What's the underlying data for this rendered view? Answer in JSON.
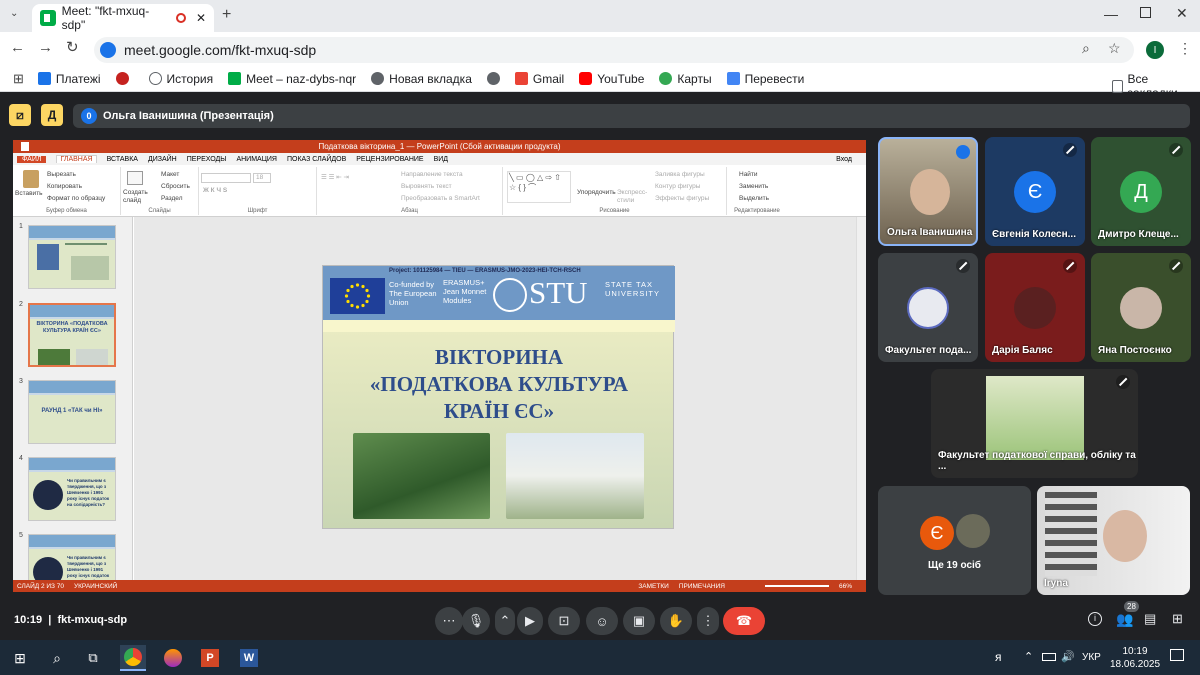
{
  "browser": {
    "tab_title": "Meet: \"fkt-mxuq-sdp\"",
    "url": "meet.google.com/fkt-mxuq-sdp",
    "profile_initial": "I",
    "bookmarks": [
      {
        "label": "Платежі",
        "color": "#1a73e8"
      },
      {
        "label": "",
        "color": "#c5221f"
      },
      {
        "label": "История",
        "color": "#5f6368"
      },
      {
        "label": "Meet – naz-dybs-nqr",
        "color": "#00ac47"
      },
      {
        "label": "Новая вкладка",
        "color": "#5f6368"
      },
      {
        "label": "Gmail",
        "color": "#ea4335"
      },
      {
        "label": "YouTube",
        "color": "#ff0000"
      },
      {
        "label": "Карты",
        "color": "#34a853"
      },
      {
        "label": "Перевести",
        "color": "#4285f4"
      }
    ],
    "all_bookmarks": "Все закладки"
  },
  "meet": {
    "presenter_count": "0",
    "presenter_label": "Ольга Іванишина (Презентація)",
    "badge_a": "Д",
    "participants": [
      {
        "name": "Ольга Іванишина",
        "initial": "",
        "color": "#8a7a60"
      },
      {
        "name": "Євгенія Колесн...",
        "initial": "Є",
        "color": "#1a73e8"
      },
      {
        "name": "Дмитро Клеще...",
        "initial": "Д",
        "color": "#34a853"
      },
      {
        "name": "Факультет пода...",
        "initial": "",
        "color": "#5c6bc0"
      },
      {
        "name": "Дарія Баляс",
        "initial": "",
        "color": "#8b1c1c"
      },
      {
        "name": "Яна Постоєнко",
        "initial": "",
        "color": "#33691e"
      }
    ],
    "shared_tile_name": "Факультет податкової справи, обліку та ...",
    "others_label": "Ще 19 осіб",
    "others_initial": "Є",
    "iryna_name": "Iryna",
    "time": "10:19",
    "meeting_code": "fkt-mxuq-sdp",
    "participants_count": "28"
  },
  "ppt": {
    "title": "Податкова вікторина_1 — PowerPoint (Сбой активации продукта)",
    "login": "Вход",
    "tabs": [
      "ФАЙЛ",
      "ГЛАВНАЯ",
      "ВСТАВКА",
      "ДИЗАЙН",
      "ПЕРЕХОДЫ",
      "АНИМАЦИЯ",
      "ПОКАЗ СЛАЙДОВ",
      "РЕЦЕНЗИРОВАНИЕ",
      "ВИД"
    ],
    "ribbon": {
      "paste": "Вставить",
      "cut": "Вырезать",
      "copy": "Копировать",
      "format_painter": "Формат по образцу",
      "clipboard_group": "Буфер обмена",
      "new_slide": "Создать слайд",
      "layout": "Макет",
      "reset": "Сбросить",
      "section": "Раздел",
      "slides_group": "Слайды",
      "font_size": "18",
      "font_group": "Шрифт",
      "text_direction": "Направление текста",
      "align_text": "Выровнять текст",
      "smartart": "Преобразовать в SmartArt",
      "paragraph_group": "Абзац",
      "arrange": "Упорядочить",
      "quick_styles": "Экспресс-стили",
      "shape_fill": "Заливка фигуры",
      "shape_outline": "Контур фигуры",
      "shape_effects": "Эффекты фигуры",
      "drawing_group": "Рисование",
      "find": "Найти",
      "replace": "Заменить",
      "select": "Выделить",
      "editing_group": "Редактирование"
    },
    "thumbs": [
      {
        "num": "1",
        "text": ""
      },
      {
        "num": "2",
        "text": "ВІКТОРИНА «ПОДАТКОВА КУЛЬТУРА КРАЇН ЄС»"
      },
      {
        "num": "3",
        "text": "РАУНД 1 «ТАК чи НІ»"
      },
      {
        "num": "4",
        "text": "Чи правильним є твердження, що з Шевченко і 1991 року існує податок на солідарність?"
      },
      {
        "num": "5",
        "text": "Чи правильним є твердження, що з Шевченко і 1991 року існує податок на солідарність?"
      }
    ],
    "slide": {
      "project": "Project: 101125984 — TIEU — ERASMUS-JMO-2023-HEI-TCH-RSCH",
      "cofunded": "Co-funded by The European Union",
      "erasmus": "ERASMUS+ Jean Monnet Modules",
      "stu": "STU",
      "stu_full": "STATE TAX UNIVERSITY",
      "title_line1": "ВІКТОРИНА",
      "title_line2": "«ПОДАТКОВА КУЛЬТУРА",
      "title_line3": "КРАЇН ЄС»"
    },
    "status_left": "СЛАЙД 2 ИЗ 70",
    "status_lang": "УКРАИНСКИЙ",
    "status_notes": "ЗАМЕТКИ",
    "status_comments": "ПРИМЕЧАНИЯ",
    "zoom": "66%"
  },
  "taskbar": {
    "lang": "УКР",
    "time": "10:19",
    "date": "18.06.2025"
  }
}
